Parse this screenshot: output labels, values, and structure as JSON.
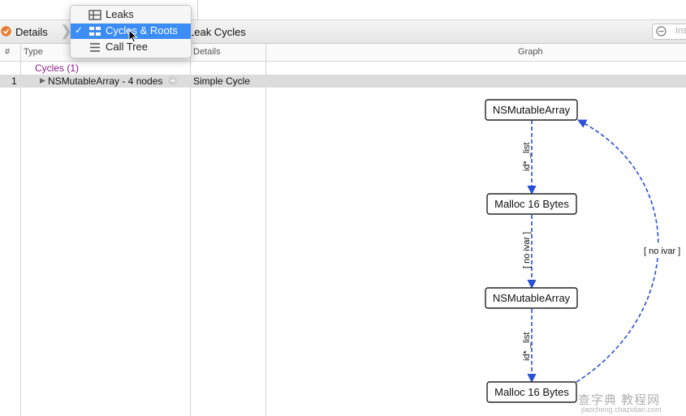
{
  "toolbar": {
    "details_label": "Details",
    "breadcrumb_current": "Leak Cycles",
    "search_placeholder": "Ins"
  },
  "menu": {
    "items": [
      {
        "label": "Leaks",
        "checked": false
      },
      {
        "label": "Cycles & Roots",
        "checked": true,
        "check_mark": "✓"
      },
      {
        "label": "Call Tree",
        "checked": false
      }
    ]
  },
  "columns": {
    "index": "#",
    "type": "Type",
    "details": "Details",
    "graph": "Graph"
  },
  "table": {
    "group_label": "Cycles (1)",
    "rows": [
      {
        "index": "1",
        "type": "NSMutableArray - 4 nodes",
        "details": "Simple Cycle"
      }
    ]
  },
  "graph": {
    "nodes": [
      {
        "label": "NSMutableArray"
      },
      {
        "label": "Malloc 16 Bytes"
      },
      {
        "label": "NSMutableArray"
      },
      {
        "label": "Malloc 16 Bytes"
      }
    ],
    "edges": [
      {
        "label": "id* _list"
      },
      {
        "label": "[ no ivar ]"
      },
      {
        "label": "id* _list"
      },
      {
        "label": "[ no ivar ]"
      }
    ],
    "edge_color": "#2a4fd6"
  },
  "watermark": {
    "text": "查字典 教程网",
    "sub": "jiaocheng.chazidian.com"
  },
  "colors": {
    "menu_selected": "#3b8cf5",
    "group_label": "#8a1a8a"
  }
}
